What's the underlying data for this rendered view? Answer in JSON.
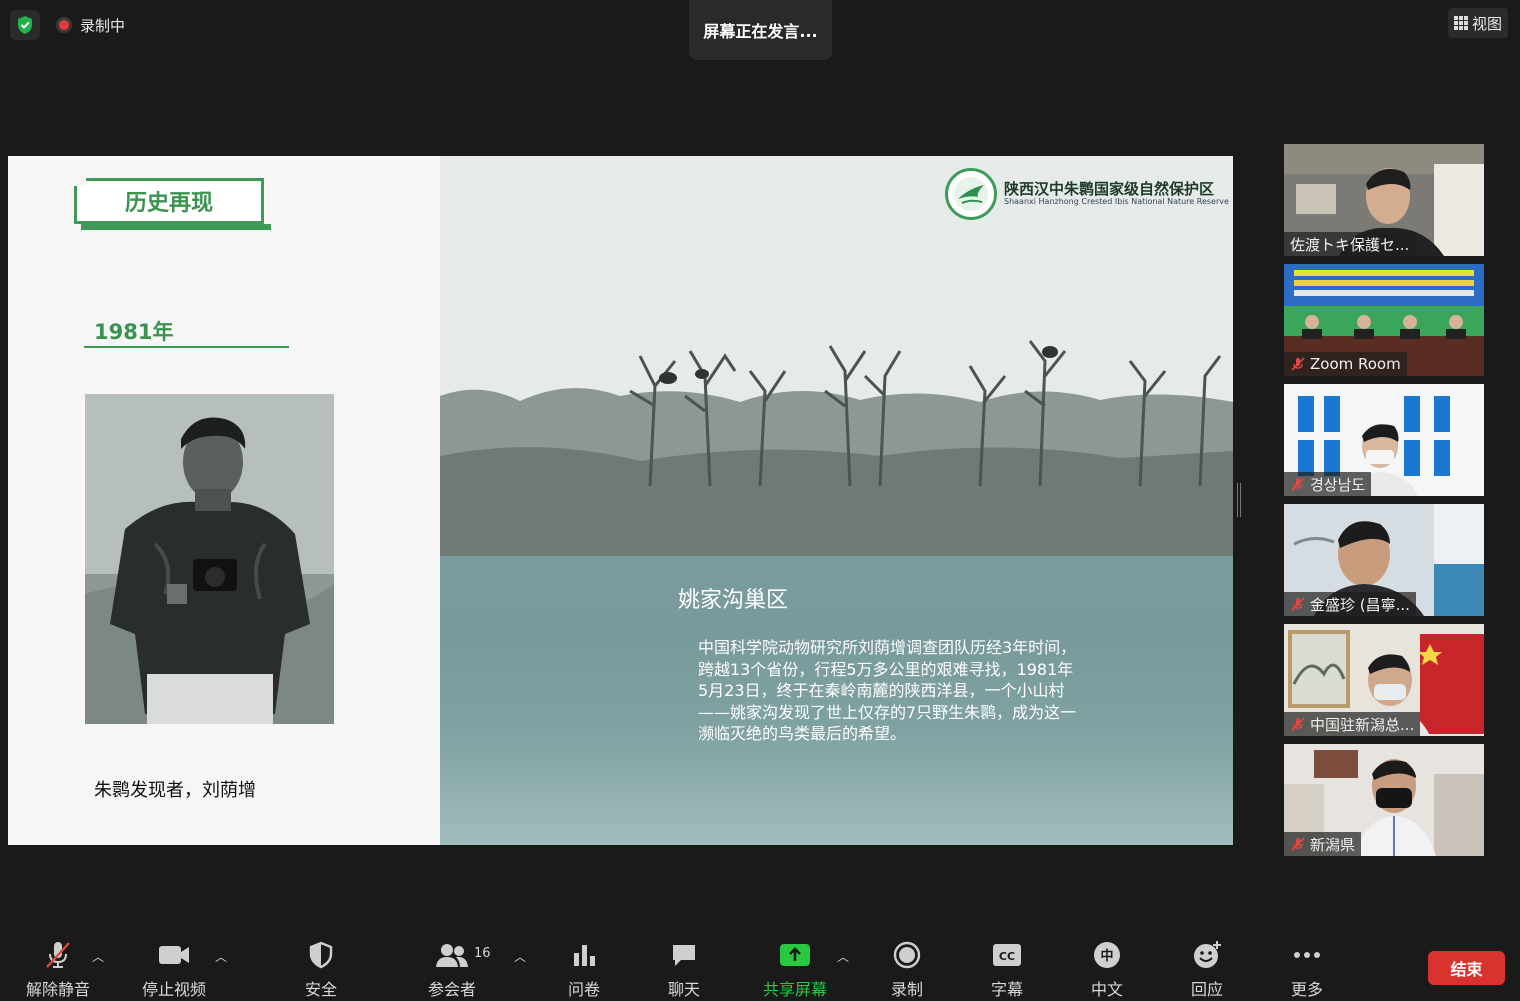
{
  "topbar": {
    "recording_label": "录制中",
    "speaking_label": "屏幕正在发言...",
    "view_label": "视图"
  },
  "slide": {
    "section_title": "历史再现",
    "year": "1981年",
    "portrait_caption": "朱鹮发现者，刘荫增",
    "org_name_cn": "陕西汉中朱鹮国家级自然保护区",
    "org_name_en": "Shaanxi Hanzhong Crested Ibis National Nature Reserve",
    "area_title": "姚家沟巢区",
    "area_description": "中国科学院动物研究所刘荫增调查团队历经3年时间，跨越13个省份，行程5万多公里的艰难寻找，1981年5月23日，终于在秦岭南麓的陕西洋县，一个小山村——姚家沟发现了世上仅存的7只野生朱鹮，成为这一濒临灭绝的鸟类最后的希望。"
  },
  "participants": [
    {
      "name": "佐渡トキ保護セ...",
      "muted": false
    },
    {
      "name": "Zoom Room",
      "muted": true
    },
    {
      "name": "경상남도",
      "muted": true
    },
    {
      "name": "金盛珍 (昌寧...",
      "muted": true
    },
    {
      "name": "中国驻新潟总...",
      "muted": true
    },
    {
      "name": "新潟県",
      "muted": true
    }
  ],
  "toolbar": {
    "unmute_label": "解除静音",
    "stop_video_label": "停止视频",
    "security_label": "安全",
    "participants_label": "参会者",
    "participants_count": "16",
    "polls_label": "问卷",
    "chat_label": "聊天",
    "share_label": "共享屏幕",
    "record_label": "录制",
    "captions_label": "字幕",
    "cc_text": "CC",
    "language_label": "中文",
    "language_glyph": "中",
    "reactions_label": "回应",
    "more_label": "更多",
    "end_label": "结束"
  },
  "colors": {
    "accent_green": "#3f9a56",
    "share_green": "#28c840",
    "end_red": "#d93330",
    "background": "#1a1a1a"
  }
}
